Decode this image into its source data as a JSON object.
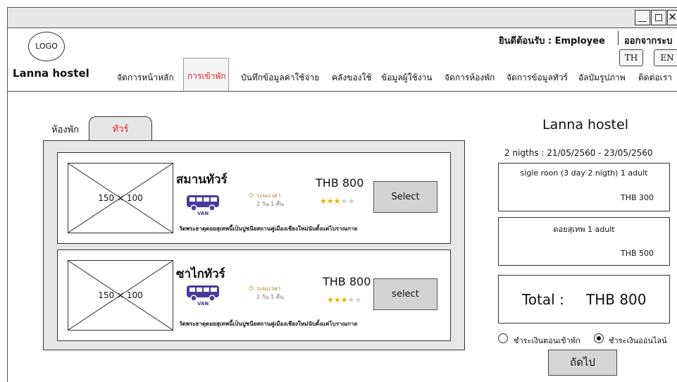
{
  "window": {
    "minimize_icon": "minimize-icon",
    "maximize_icon": "maximize-icon",
    "close_glyph": "✕"
  },
  "header": {
    "logo": "LOGO",
    "brand": "Lanna hostel",
    "welcome": "ยินดีต้อนรับ : Employee",
    "logout": "ออกจากระบ",
    "lang_th": "TH",
    "lang_en": "EN"
  },
  "nav": {
    "items": [
      "จัดการหน้าหลัก",
      "การเข้าพัก",
      "บันทึกข้อมูลค่าใช้จ่าย",
      "คลังของใช้",
      "ข้อมูลผู้ใช้งาน",
      "จัดการห้องพัก",
      "จัดการข้อมูลทัวร์",
      "อัลบัมรูปภาพ",
      "ติดต่อเรา"
    ],
    "active_index": 1,
    "active_color": "#e02020"
  },
  "tabs": {
    "rooms": "ห้องพัก",
    "tour": "ทัวร์"
  },
  "tours": [
    {
      "image": "150 × 100",
      "name": "สมานทัวร์",
      "vehicle": "VAN",
      "duration_label": "ระยะเวลา",
      "duration_value": "2 วัน 1 คืน",
      "price": "THB  800",
      "rating": 3,
      "max_rating": 5,
      "button": "Select",
      "description": "วัดพระธาตุดอยสุเทพนี้เป็นปูชนียสถานคู่เมืองเชียงใหม่นับตั้งแต่โบราณกาล"
    },
    {
      "image": "150 × 100",
      "name": "ซาไกทัวร์",
      "vehicle": "VAN",
      "duration_label": "ระยะเวลา",
      "duration_value": "2 วัน 1 คืน",
      "price": "THB  800",
      "rating": 3,
      "max_rating": 5,
      "button": "select",
      "description": "วัดพระธาตุดอยสุเทพนี้เป็นปูชนียสถานคู่เมืองเชียงใหม่นับตั้งแต่โบราณกาล"
    }
  ],
  "summary": {
    "title": "Lanna hostel",
    "nights": "2 nigths : 21/05/2560  -  23/05/2560",
    "items": [
      {
        "label": "sigle roon (3 day 2 nigth) 1 adult",
        "price": "THB  300"
      },
      {
        "label": "ดอยสุเทพ 1 adult",
        "price": "THB  500"
      }
    ],
    "total_label": "Total :",
    "total_value": "THB  800",
    "payment_options": [
      {
        "label": "ชำระเงินตอนเข้าพัก",
        "checked": false
      },
      {
        "label": "ชำระเงินออนไลน์",
        "checked": true
      }
    ],
    "next_button": "ถัดไป"
  },
  "colors": {
    "van": "#4a3a9a",
    "star_on": "#e8b000",
    "star_off": "#cfcfcf",
    "panel_bg": "#e6e6e6",
    "button_bg": "#d3d3d3"
  }
}
